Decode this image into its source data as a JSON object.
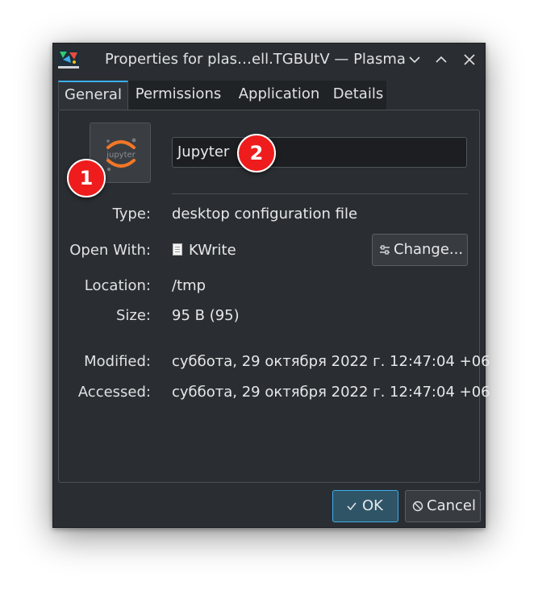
{
  "window": {
    "title": "Properties for plas…ell.TGBUtV — Plasma",
    "accent_color": "#3daee9"
  },
  "tabs": [
    {
      "label": "General",
      "active": true
    },
    {
      "label": "Permissions",
      "active": false
    },
    {
      "label": "Application",
      "active": false
    },
    {
      "label": "Details",
      "active": false
    }
  ],
  "general": {
    "icon": "jupyter-logo-icon",
    "icon_text": "jupyter",
    "name_value": "Jupyter",
    "type_label": "Type:",
    "type_value": "desktop configuration file",
    "open_with_label": "Open With:",
    "open_with_value": "KWrite",
    "change_label": "Change...",
    "location_label": "Location:",
    "location_value": "/tmp",
    "size_label": "Size:",
    "size_value": "95 B (95)",
    "modified_label": "Modified:",
    "modified_value": "суббота, 29 октября 2022 г. 12:47:04 +06",
    "accessed_label": "Accessed:",
    "accessed_value": "суббота, 29 октября 2022 г. 12:47:04 +06"
  },
  "buttons": {
    "ok_label": "OK",
    "cancel_label": "Cancel"
  },
  "annotations": [
    "1",
    "2"
  ]
}
